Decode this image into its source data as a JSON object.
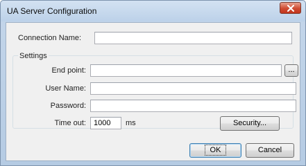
{
  "window": {
    "title": "UA Server Configuration",
    "close_icon": "close-icon"
  },
  "connection": {
    "label": "Connection Name:",
    "value": ""
  },
  "settings": {
    "legend": "Settings",
    "endpoint_label": "End point:",
    "endpoint_value": "",
    "browse_label": "...",
    "username_label": "User Name:",
    "username_value": "",
    "password_label": "Password:",
    "password_value": "",
    "timeout_label": "Time out:",
    "timeout_value": "1000",
    "timeout_unit": "ms",
    "security_label": "Security..."
  },
  "footer": {
    "ok_label": "OK",
    "cancel_label": "Cancel"
  },
  "colors": {
    "close_button": "#c84630",
    "title_bar": "#c4d6ea",
    "client_bg": "#f0f0f0"
  }
}
